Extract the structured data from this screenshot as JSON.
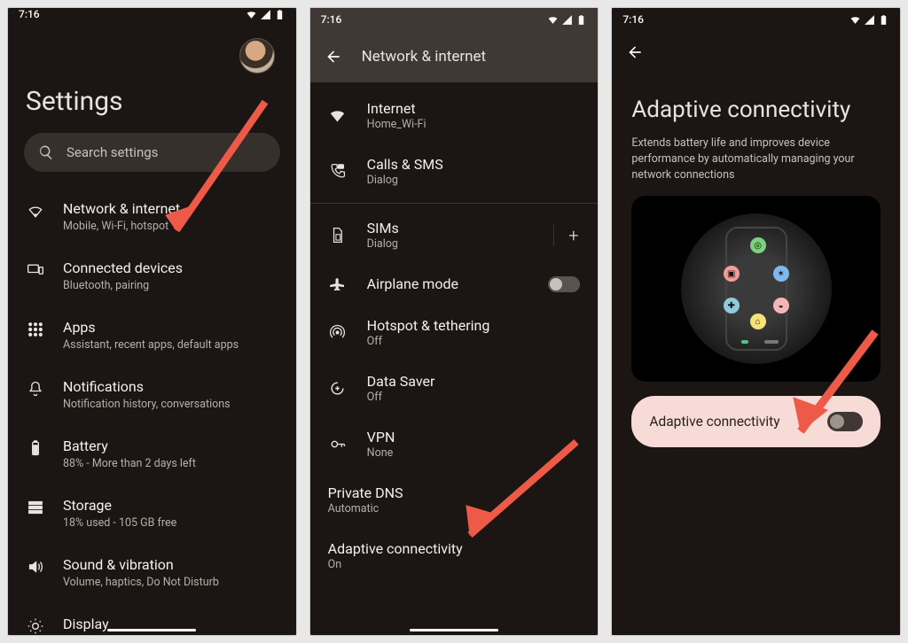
{
  "status": {
    "time": "7:16"
  },
  "screen1": {
    "title": "Settings",
    "search_placeholder": "Search settings",
    "items": [
      {
        "title": "Network & internet",
        "sub": "Mobile, Wi-Fi, hotspot"
      },
      {
        "title": "Connected devices",
        "sub": "Bluetooth, pairing"
      },
      {
        "title": "Apps",
        "sub": "Assistant, recent apps, default apps"
      },
      {
        "title": "Notifications",
        "sub": "Notification history, conversations"
      },
      {
        "title": "Battery",
        "sub": "88% - More than 2 days left"
      },
      {
        "title": "Storage",
        "sub": "18% used - 105 GB free"
      },
      {
        "title": "Sound & vibration",
        "sub": "Volume, haptics, Do Not Disturb"
      },
      {
        "title": "Display",
        "sub": ""
      }
    ]
  },
  "screen2": {
    "header": "Network & internet",
    "items": [
      {
        "title": "Internet",
        "sub": "Home_Wi-Fi"
      },
      {
        "title": "Calls & SMS",
        "sub": "Dialog"
      },
      {
        "title": "SIMs",
        "sub": "Dialog"
      },
      {
        "title": "Airplane mode",
        "sub": ""
      },
      {
        "title": "Hotspot & tethering",
        "sub": "Off"
      },
      {
        "title": "Data Saver",
        "sub": "Off"
      },
      {
        "title": "VPN",
        "sub": "None"
      },
      {
        "title": "Private DNS",
        "sub": "Automatic"
      },
      {
        "title": "Adaptive connectivity",
        "sub": "On"
      }
    ]
  },
  "screen3": {
    "title": "Adaptive connectivity",
    "desc": "Extends battery life and improves device performance by automatically managing your network connections",
    "toggle_label": "Adaptive connectivity"
  }
}
